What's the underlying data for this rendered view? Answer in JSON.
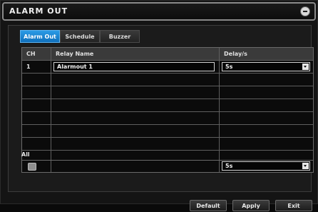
{
  "window": {
    "title": "ALARM OUT"
  },
  "tabs": [
    {
      "label": "Alarm Out",
      "active": true
    },
    {
      "label": "Schedule",
      "active": false
    },
    {
      "label": "Buzzer",
      "active": false
    }
  ],
  "table": {
    "headers": {
      "ch": "CH",
      "relay_name": "Relay Name",
      "delay": "Delay/s"
    },
    "rows": [
      {
        "ch": "1",
        "relay_name": "Alarmout 1",
        "delay": "5s"
      }
    ]
  },
  "all": {
    "label": "All",
    "delay": "5s",
    "checked": false
  },
  "buttons": {
    "default": "Default",
    "apply": "Apply",
    "exit": "Exit"
  },
  "colors": {
    "active_tab": "#1f86d4",
    "background": "#141414"
  },
  "icons": {
    "close": "close-icon",
    "dropdown": "chevron-down-icon"
  }
}
